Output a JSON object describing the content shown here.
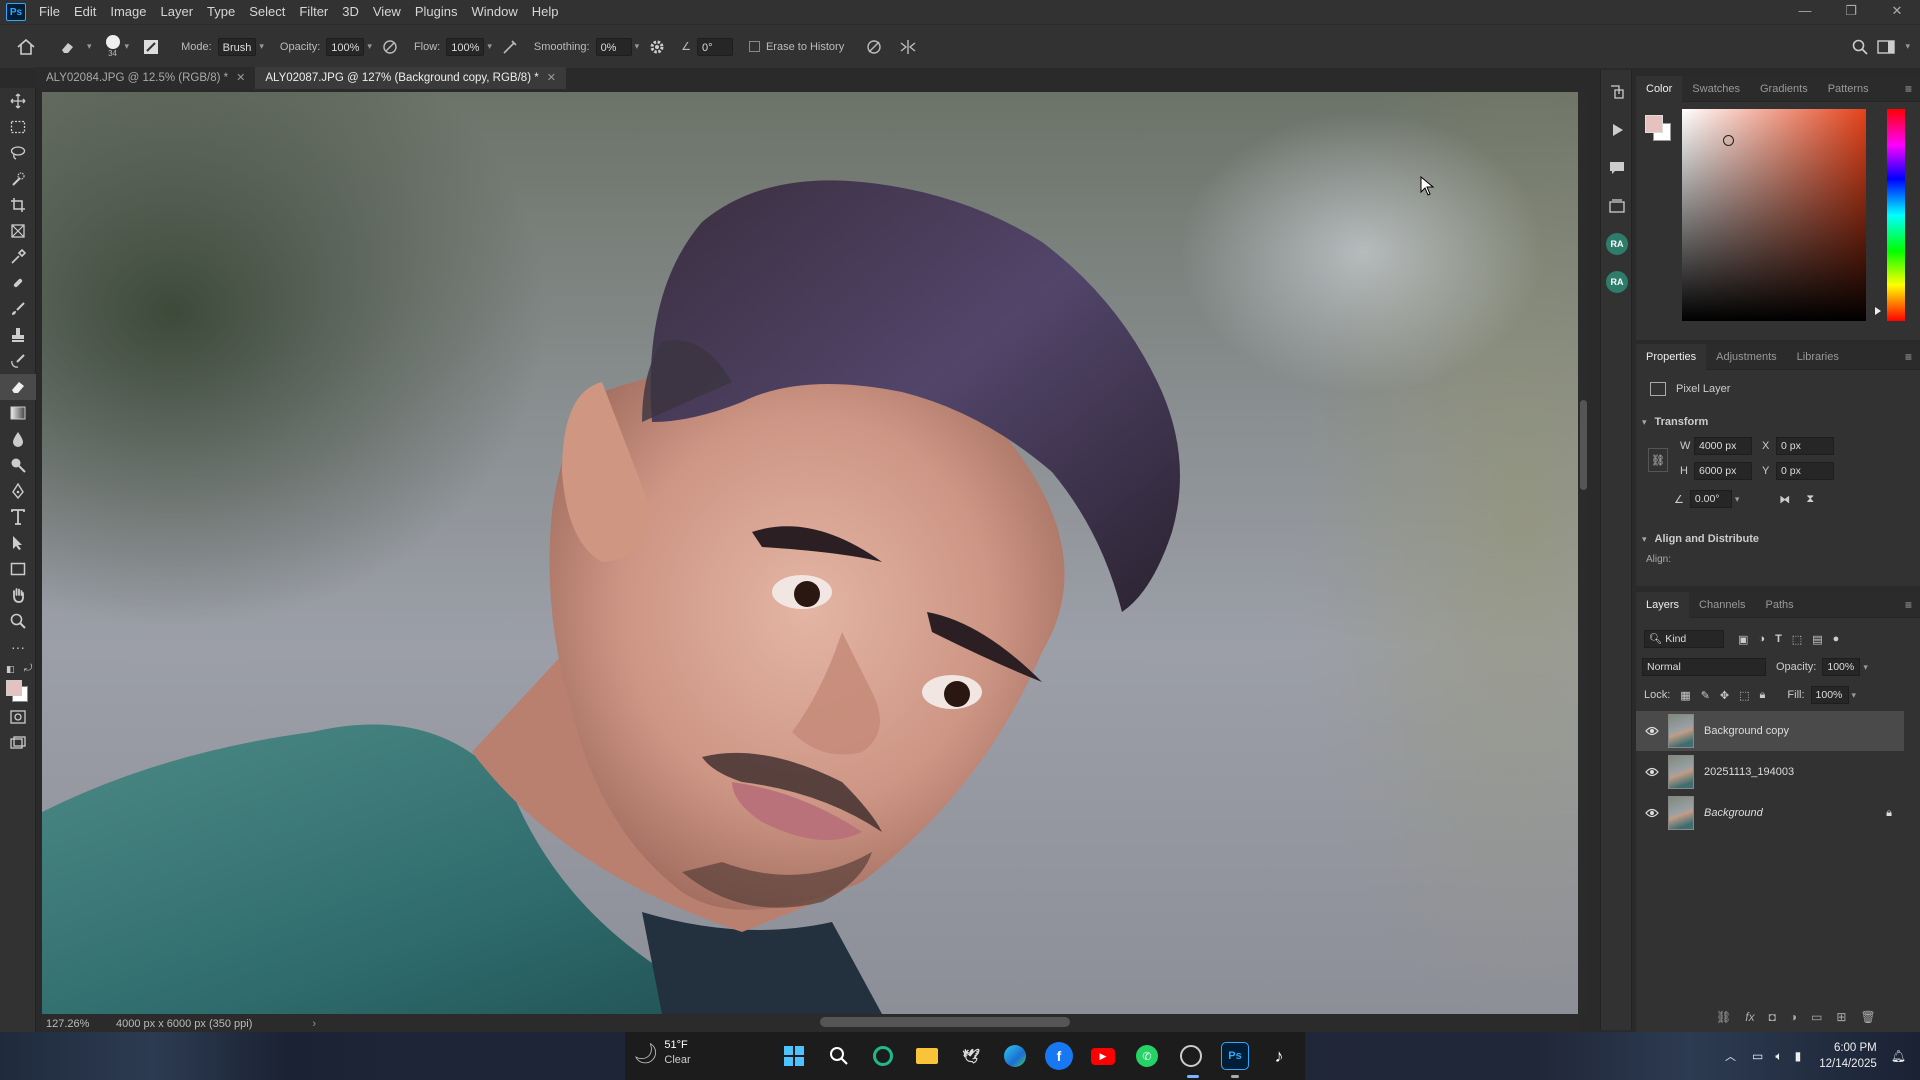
{
  "app": {
    "logo": "Ps"
  },
  "menu": [
    "File",
    "Edit",
    "Image",
    "Layer",
    "Type",
    "Select",
    "Filter",
    "3D",
    "View",
    "Plugins",
    "Window",
    "Help"
  ],
  "options": {
    "brush_size": "34",
    "mode_label": "Mode:",
    "mode_value": "Brush",
    "opacity_label": "Opacity:",
    "opacity_value": "100%",
    "flow_label": "Flow:",
    "flow_value": "100%",
    "smoothing_label": "Smoothing:",
    "smoothing_value": "0%",
    "angle_value": "0°",
    "erase_history_label": "Erase to History"
  },
  "tabs": [
    {
      "label": "ALY02084.JPG @ 12.5% (RGB/8) *"
    },
    {
      "label": "ALY02087.JPG @ 127% (Background copy, RGB/8) *"
    }
  ],
  "status": {
    "zoom": "127.26%",
    "doc_info": "4000 px x 6000 px (350 ppi)"
  },
  "color_panel": {
    "tabs": [
      "Color",
      "Swatches",
      "Gradients",
      "Patterns"
    ],
    "foreground": "#e6c2be",
    "background": "#ffffff"
  },
  "properties_panel": {
    "tabs": [
      "Properties",
      "Adjustments",
      "Libraries"
    ],
    "kind": "Pixel Layer",
    "transform_label": "Transform",
    "w_label": "W",
    "w_value": "4000 px",
    "h_label": "H",
    "h_value": "6000 px",
    "x_label": "X",
    "x_value": "0 px",
    "y_label": "Y",
    "y_value": "0 px",
    "angle_value": "0.00°",
    "align_label": "Align and Distribute",
    "align_sub": "Align:"
  },
  "layers_panel": {
    "tabs": [
      "Layers",
      "Channels",
      "Paths"
    ],
    "filter_kind": "Kind",
    "blend_mode": "Normal",
    "opacity_label": "Opacity:",
    "opacity_value": "100%",
    "lock_label": "Lock:",
    "fill_label": "Fill:",
    "fill_value": "100%",
    "layers": [
      {
        "name": "Background copy"
      },
      {
        "name": "20251113_194003"
      },
      {
        "name": "Background"
      }
    ]
  },
  "taskbar": {
    "weather_temp": "51°F",
    "weather_desc": "Clear",
    "time": "6:00 PM",
    "date": "12/14/2025"
  }
}
